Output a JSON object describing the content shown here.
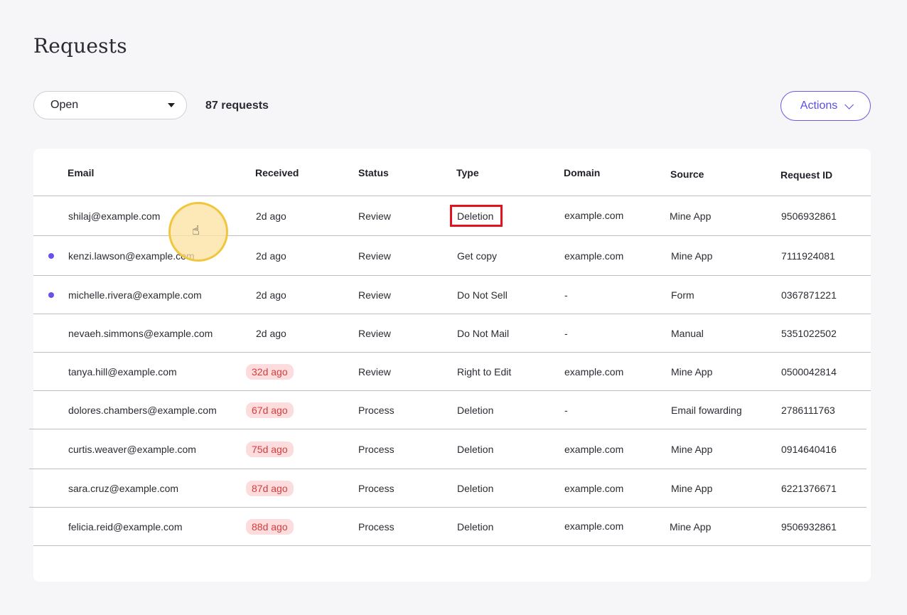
{
  "page": {
    "title": "Requests"
  },
  "filter": {
    "selected": "Open"
  },
  "summary": {
    "count_label": "87 requests"
  },
  "actions": {
    "label": "Actions"
  },
  "table": {
    "headers": {
      "email": "Email",
      "received": "Received",
      "status": "Status",
      "type": "Type",
      "domain": "Domain",
      "source": "Source",
      "request_id": "Request ID"
    },
    "rows": [
      {
        "email": "shilaj@example.com",
        "received": "2d ago",
        "status": "Review",
        "type": "Deletion",
        "domain": "example.com",
        "source": "Mine App",
        "request_id": "9506932861"
      },
      {
        "email": "kenzi.lawson@example.com",
        "received": "2d ago",
        "status": "Review",
        "type": "Get copy",
        "domain": "example.com",
        "source": "Mine App",
        "request_id": "7111924081"
      },
      {
        "email": "michelle.rivera@example.com",
        "received": "2d ago",
        "status": "Review",
        "type": "Do Not Sell",
        "domain": "-",
        "source": "Form",
        "request_id": "0367871221"
      },
      {
        "email": "nevaeh.simmons@example.com",
        "received": "2d ago",
        "status": "Review",
        "type": "Do Not Mail",
        "domain": "-",
        "source": "Manual",
        "request_id": "5351022502"
      },
      {
        "email": "tanya.hill@example.com",
        "received": "32d ago",
        "status": "Review",
        "type": "Right to Edit",
        "domain": "example.com",
        "source": "Mine App",
        "request_id": "0500042814"
      },
      {
        "email": "dolores.chambers@example.com",
        "received": "67d ago",
        "status": "Process",
        "type": "Deletion",
        "domain": "-",
        "source": "Email fowarding",
        "request_id": "2786111763"
      },
      {
        "email": "curtis.weaver@example.com",
        "received": "75d ago",
        "status": "Process",
        "type": "Deletion",
        "domain": "example.com",
        "source": "Mine App",
        "request_id": "0914640416"
      },
      {
        "email": "sara.cruz@example.com",
        "received": "87d ago",
        "status": "Process",
        "type": "Deletion",
        "domain": "example.com",
        "source": "Mine App",
        "request_id": "6221376671"
      },
      {
        "email": "felicia.reid@example.com",
        "received": "88d ago",
        "status": "Process",
        "type": "Deletion",
        "domain": "example.com",
        "source": "Mine App",
        "request_id": "9506932861"
      }
    ]
  },
  "colors": {
    "accent": "#5b4fe0",
    "unread_dot": "#6652e8",
    "overdue_badge_bg": "#fcdcdc",
    "overdue_badge_text": "#d33d3d",
    "highlight": "#e3121d"
  },
  "icons": {
    "filter_caret": "caret-down-icon",
    "actions_chevron": "chevron-down-icon",
    "cursor": "hand-pointer-icon"
  }
}
